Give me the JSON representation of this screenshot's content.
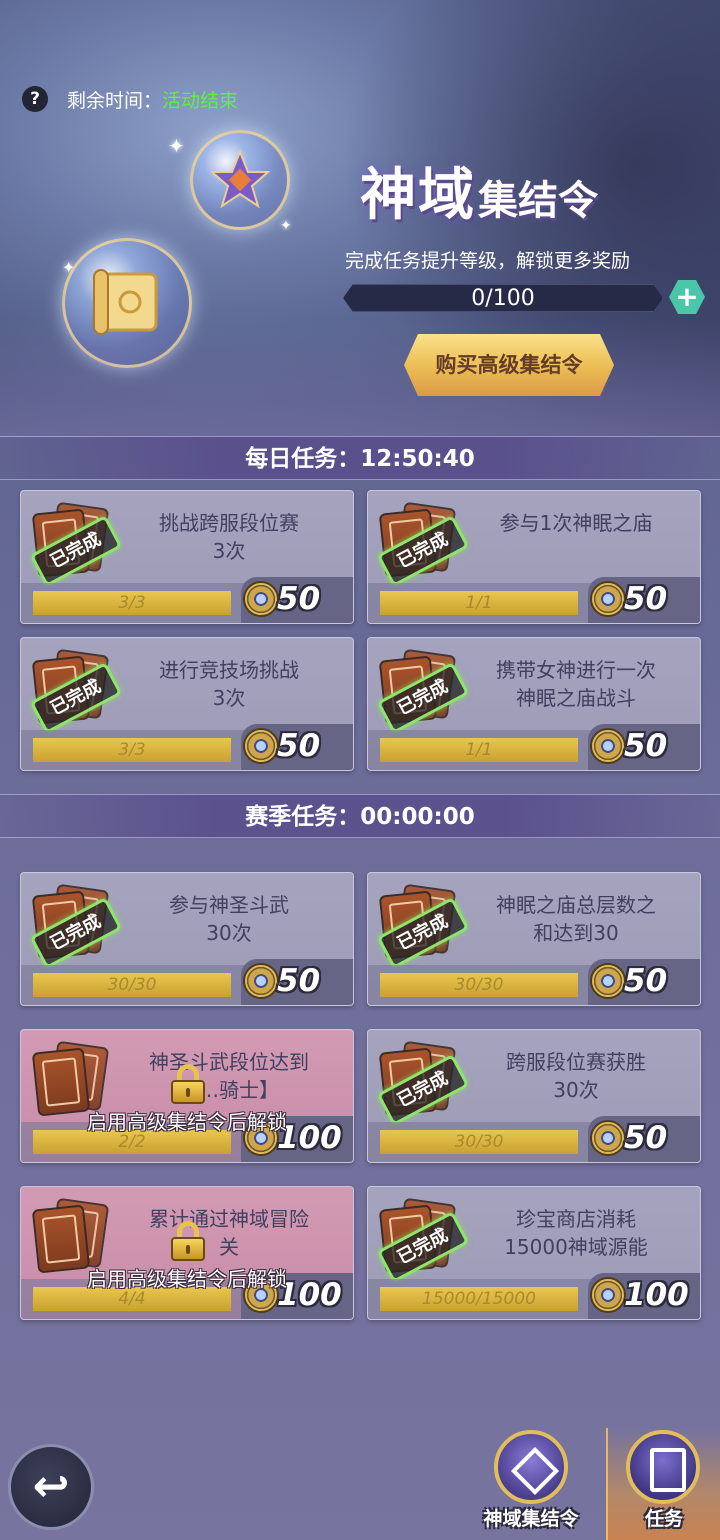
{
  "header": {
    "help_icon": "?",
    "remain_label": "剩余时间：",
    "remain_status": "活动结束",
    "title_big": "神域",
    "title_small": "集结令",
    "subtitle": "完成任务提升等级，解锁更多奖励",
    "progress": {
      "text": "0/100",
      "value": 0,
      "max": 100
    },
    "plus_label": "+",
    "buy_button": "购买高级集结令"
  },
  "daily": {
    "title": "每日任务：",
    "timer": "12:50:40",
    "tasks": [
      {
        "text": "挑战跨服段位赛\n3次",
        "progress": "3/3",
        "fraction": 1,
        "reward": "50",
        "status": "已完成"
      },
      {
        "text": "参与1次神眠之庙",
        "progress": "1/1",
        "fraction": 1,
        "reward": "50",
        "status": "已完成"
      },
      {
        "text": "进行竞技场挑战\n3次",
        "progress": "3/3",
        "fraction": 1,
        "reward": "50",
        "status": "已完成"
      },
      {
        "text": "携带女神进行一次\n神眠之庙战斗",
        "progress": "1/1",
        "fraction": 1,
        "reward": "50",
        "status": "已完成"
      }
    ]
  },
  "season": {
    "title": "赛季任务：",
    "timer": "00:00:00",
    "tasks": [
      {
        "text": "参与神圣斗武\n30次",
        "progress": "30/30",
        "fraction": 1,
        "reward": "50",
        "status": "已完成"
      },
      {
        "text": "神眠之庙总层数之\n和达到30",
        "progress": "30/30",
        "fraction": 1,
        "reward": "50",
        "status": "已完成"
      },
      {
        "text": "神圣斗武段位达到\n【…骑士】",
        "progress": "2/2",
        "fraction": 1,
        "reward": "100",
        "locked": "启用高级集结令后解锁"
      },
      {
        "text": "跨服段位赛获胜\n30次",
        "progress": "30/30",
        "fraction": 1,
        "reward": "50",
        "status": "已完成"
      },
      {
        "text": "累计通过神域冒险\n关",
        "progress": "4/4",
        "fraction": 1,
        "reward": "100",
        "locked": "启用高级集结令后解锁"
      },
      {
        "text": "珍宝商店消耗\n15000神域源能",
        "progress": "15000/15000",
        "fraction": 1,
        "reward": "100",
        "status": "已完成"
      }
    ]
  },
  "nav": {
    "back_icon": "↩",
    "pass_label": "神域集结令",
    "task_label": "任务"
  },
  "colors": {
    "accent_green": "#5ef04a",
    "gold": "#e3c15a",
    "stamp_green": "#8fe56b"
  }
}
